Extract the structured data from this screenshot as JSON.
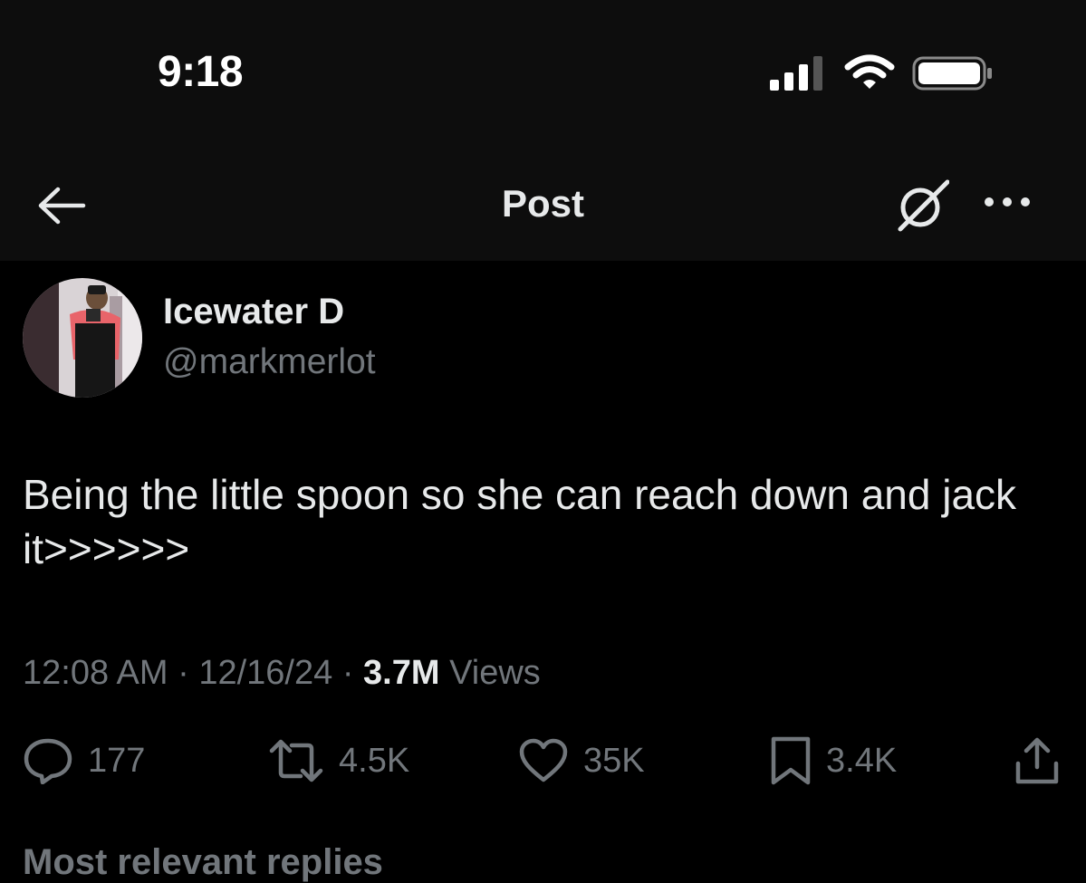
{
  "status_bar": {
    "time": "9:18"
  },
  "nav": {
    "title": "Post"
  },
  "tweet": {
    "display_name": "Icewater D",
    "handle": "@markmerlot",
    "text": "Being the little spoon so she can reach down and jack it>>>>>>",
    "time": "12:08 AM",
    "date": "12/16/24",
    "views_count": "3.7M",
    "views_label": "Views"
  },
  "actions": {
    "replies": "177",
    "reposts": "4.5K",
    "likes": "35K",
    "bookmarks": "3.4K"
  },
  "replies_section": {
    "heading": "Most relevant replies"
  },
  "colors": {
    "background": "#000000",
    "header_background": "#0d0d0d",
    "primary_text": "#e7e9ea",
    "secondary_text": "#71767b"
  },
  "icons": [
    "back-arrow-icon",
    "grok-icon",
    "more-icon",
    "reply-icon",
    "repost-icon",
    "like-icon",
    "bookmark-icon",
    "share-icon",
    "signal-icon",
    "wifi-icon",
    "battery-icon"
  ]
}
